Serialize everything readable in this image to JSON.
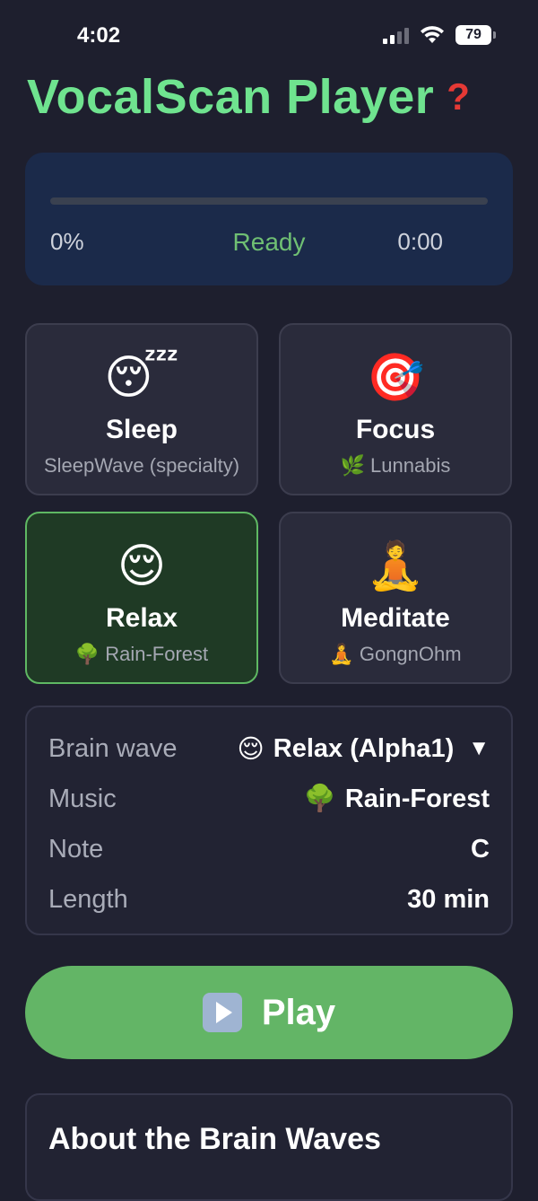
{
  "status_bar": {
    "time": "4:02",
    "battery": "79"
  },
  "header": {
    "title": "VocalScan Player",
    "help_icon": "question-mark-icon"
  },
  "progress": {
    "percent_label": "0%",
    "status": "Ready",
    "elapsed": "0:00",
    "fill_fraction": 0
  },
  "modes": [
    {
      "emoji": "😴",
      "title": "Sleep",
      "subtitle_icon": "",
      "subtitle": "SleepWave (specialty)",
      "selected": false
    },
    {
      "emoji": "🎯",
      "title": "Focus",
      "subtitle_icon": "🌿",
      "subtitle": "Lunnabis",
      "selected": false
    },
    {
      "emoji": "😌",
      "title": "Relax",
      "subtitle_icon": "🌳",
      "subtitle": "Rain-Forest",
      "selected": true
    },
    {
      "emoji": "🧘",
      "title": "Meditate",
      "subtitle_icon": "🧘",
      "subtitle": "GongnOhm",
      "selected": false
    }
  ],
  "settings": {
    "brain_wave": {
      "label": "Brain wave",
      "icon": "😌",
      "value": "Relax (Alpha1)",
      "arrow": "▼"
    },
    "music": {
      "label": "Music",
      "icon": "🌳",
      "value": "Rain-Forest"
    },
    "note": {
      "label": "Note",
      "value": "C"
    },
    "length": {
      "label": "Length",
      "value": "30 min"
    }
  },
  "play": {
    "label": "Play"
  },
  "about": {
    "title": "About the Brain Waves"
  },
  "colors": {
    "accent": "#6fe38f",
    "play_green": "#63b566",
    "selected_border": "#5fb863",
    "ready_text": "#6fbf73"
  }
}
